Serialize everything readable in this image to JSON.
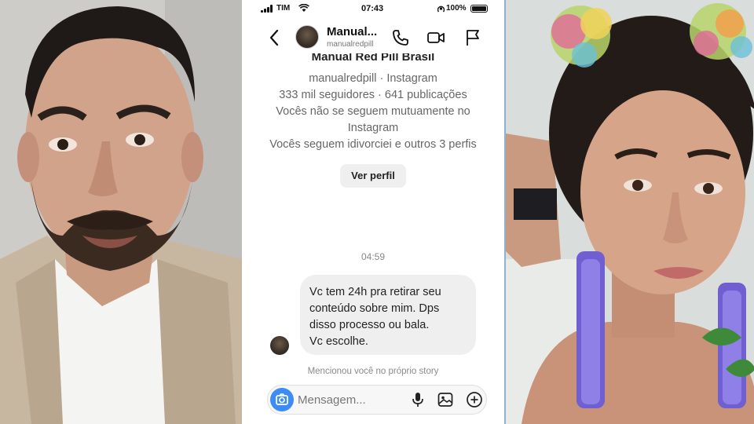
{
  "status_bar": {
    "carrier": "TIM",
    "time": "07:43",
    "battery": "100%"
  },
  "header": {
    "name": "Manual...",
    "username": "manualredpill"
  },
  "profile": {
    "title": "Manual Red Pill Brasil",
    "handle": "manualredpill · Instagram",
    "stats": "333 mil seguidores · 641 publicações",
    "mutual": "Vocês não se seguem mutuamente no Instagram",
    "follows": "Vocês seguem idivorciei e outros 3 perfis",
    "view_profile_label": "Ver perfil"
  },
  "thread": {
    "timestamp": "04:59",
    "message_lines": [
      "Vc tem 24h pra retirar seu",
      "conteúdo sobre mim. Dps",
      "disso processo ou bala.",
      "Vc escolhe."
    ],
    "mention_note": "Mencionou você no próprio story"
  },
  "composer": {
    "placeholder": "Mensagem..."
  },
  "icons": {
    "back": "chevron-left-icon",
    "call": "phone-icon",
    "video": "video-camera-icon",
    "report": "flag-icon",
    "camera": "camera-icon",
    "mic": "microphone-icon",
    "gallery": "image-icon",
    "more": "plus-circle-icon"
  },
  "colors": {
    "accent": "#3d8bf5",
    "bubble": "#efefef",
    "muted_text": "#666666"
  }
}
